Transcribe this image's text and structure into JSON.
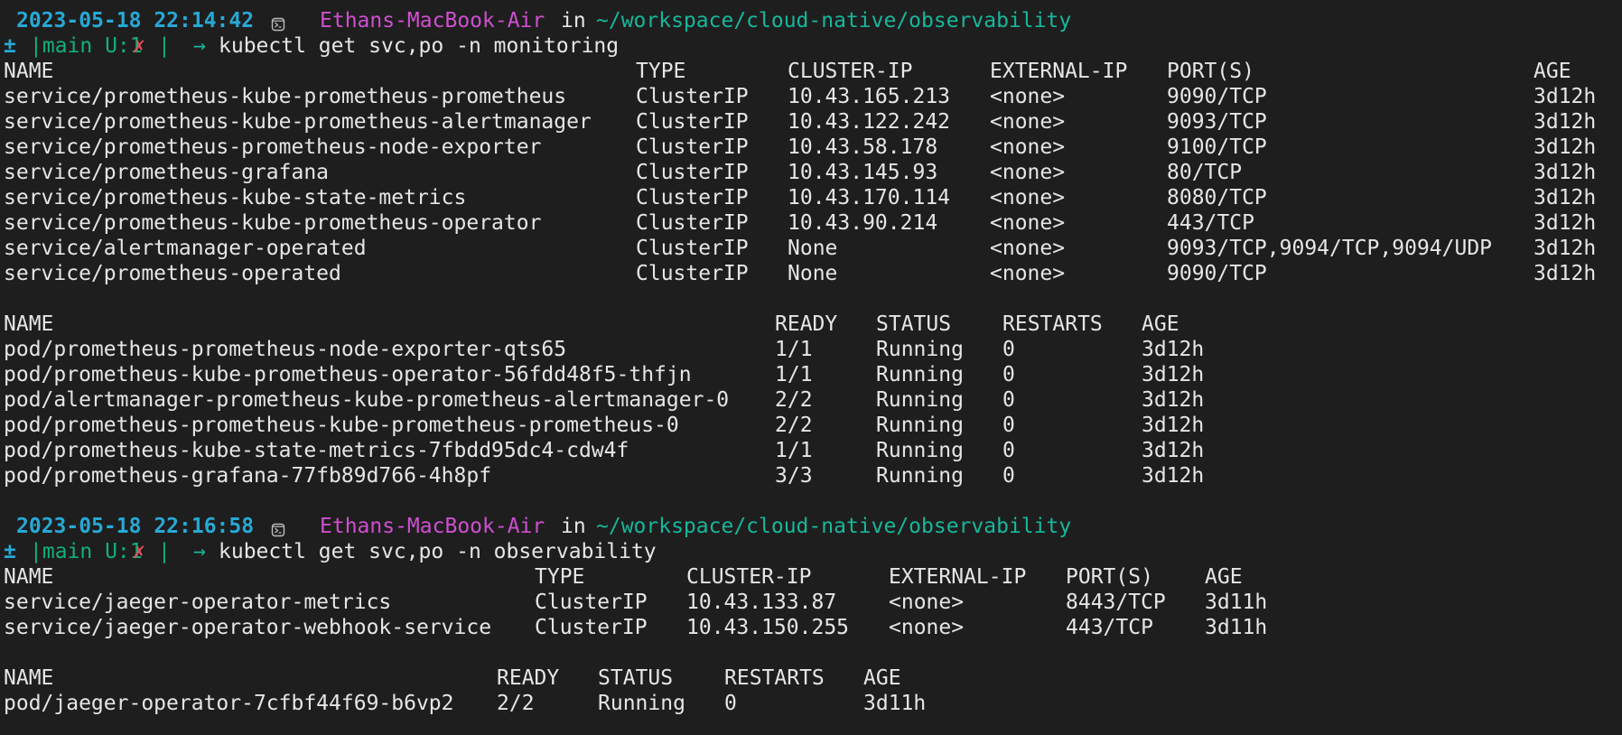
{
  "colors": {
    "background": "#1e1e1e",
    "text": "#e6e6e6",
    "timestamp": "#27a9d6",
    "host": "#cf4fd0",
    "path": "#17b79a",
    "git_branch": "#12b07a",
    "dirty_mark": "#e0505a"
  },
  "blocks": [
    {
      "prompt": {
        "timestamp": "2023-05-18 22:14:42",
        "icon": "terminal-icon",
        "host": "Ethans-MacBook-Air",
        "in_word": "in",
        "path": "~/workspace/cloud-native/observability",
        "git_prefix": "±",
        "git_status": "|main U:1",
        "dirty": "✗",
        "git_close": "|",
        "arrow": "→",
        "command": "kubectl get svc,po -n monitoring"
      },
      "services": {
        "headers": [
          "NAME",
          "TYPE",
          "CLUSTER-IP",
          "EXTERNAL-IP",
          "PORT(S)",
          "AGE"
        ],
        "rows": [
          [
            "service/prometheus-kube-prometheus-prometheus",
            "ClusterIP",
            "10.43.165.213",
            "<none>",
            "9090/TCP",
            "3d12h"
          ],
          [
            "service/prometheus-kube-prometheus-alertmanager",
            "ClusterIP",
            "10.43.122.242",
            "<none>",
            "9093/TCP",
            "3d12h"
          ],
          [
            "service/prometheus-prometheus-node-exporter",
            "ClusterIP",
            "10.43.58.178",
            "<none>",
            "9100/TCP",
            "3d12h"
          ],
          [
            "service/prometheus-grafana",
            "ClusterIP",
            "10.43.145.93",
            "<none>",
            "80/TCP",
            "3d12h"
          ],
          [
            "service/prometheus-kube-state-metrics",
            "ClusterIP",
            "10.43.170.114",
            "<none>",
            "8080/TCP",
            "3d12h"
          ],
          [
            "service/prometheus-kube-prometheus-operator",
            "ClusterIP",
            "10.43.90.214",
            "<none>",
            "443/TCP",
            "3d12h"
          ],
          [
            "service/alertmanager-operated",
            "ClusterIP",
            "None",
            "<none>",
            "9093/TCP,9094/TCP,9094/UDP",
            "3d12h"
          ],
          [
            "service/prometheus-operated",
            "ClusterIP",
            "None",
            "<none>",
            "9090/TCP",
            "3d12h"
          ]
        ]
      },
      "pods": {
        "headers": [
          "NAME",
          "READY",
          "STATUS",
          "RESTARTS",
          "AGE"
        ],
        "rows": [
          [
            "pod/prometheus-prometheus-node-exporter-qts65",
            "1/1",
            "Running",
            "0",
            "3d12h"
          ],
          [
            "pod/prometheus-kube-prometheus-operator-56fdd48f5-thfjn",
            "1/1",
            "Running",
            "0",
            "3d12h"
          ],
          [
            "pod/alertmanager-prometheus-kube-prometheus-alertmanager-0",
            "2/2",
            "Running",
            "0",
            "3d12h"
          ],
          [
            "pod/prometheus-prometheus-kube-prometheus-prometheus-0",
            "2/2",
            "Running",
            "0",
            "3d12h"
          ],
          [
            "pod/prometheus-kube-state-metrics-7fbdd95dc4-cdw4f",
            "1/1",
            "Running",
            "0",
            "3d12h"
          ],
          [
            "pod/prometheus-grafana-77fb89d766-4h8pf",
            "3/3",
            "Running",
            "0",
            "3d12h"
          ]
        ]
      }
    },
    {
      "prompt": {
        "timestamp": "2023-05-18 22:16:58",
        "icon": "terminal-icon",
        "host": "Ethans-MacBook-Air",
        "in_word": "in",
        "path": "~/workspace/cloud-native/observability",
        "git_prefix": "±",
        "git_status": "|main U:1",
        "dirty": "✗",
        "git_close": "|",
        "arrow": "→",
        "command": "kubectl get svc,po -n observability"
      },
      "services": {
        "headers": [
          "NAME",
          "TYPE",
          "CLUSTER-IP",
          "EXTERNAL-IP",
          "PORT(S)",
          "AGE"
        ],
        "rows": [
          [
            "service/jaeger-operator-metrics",
            "ClusterIP",
            "10.43.133.87",
            "<none>",
            "8443/TCP",
            "3d11h"
          ],
          [
            "service/jaeger-operator-webhook-service",
            "ClusterIP",
            "10.43.150.255",
            "<none>",
            "443/TCP",
            "3d11h"
          ]
        ]
      },
      "pods": {
        "headers": [
          "NAME",
          "READY",
          "STATUS",
          "RESTARTS",
          "AGE"
        ],
        "rows": [
          [
            "pod/jaeger-operator-7cfbf44f69-b6vp2",
            "2/2",
            "Running",
            "0",
            "3d11h"
          ]
        ]
      }
    }
  ]
}
